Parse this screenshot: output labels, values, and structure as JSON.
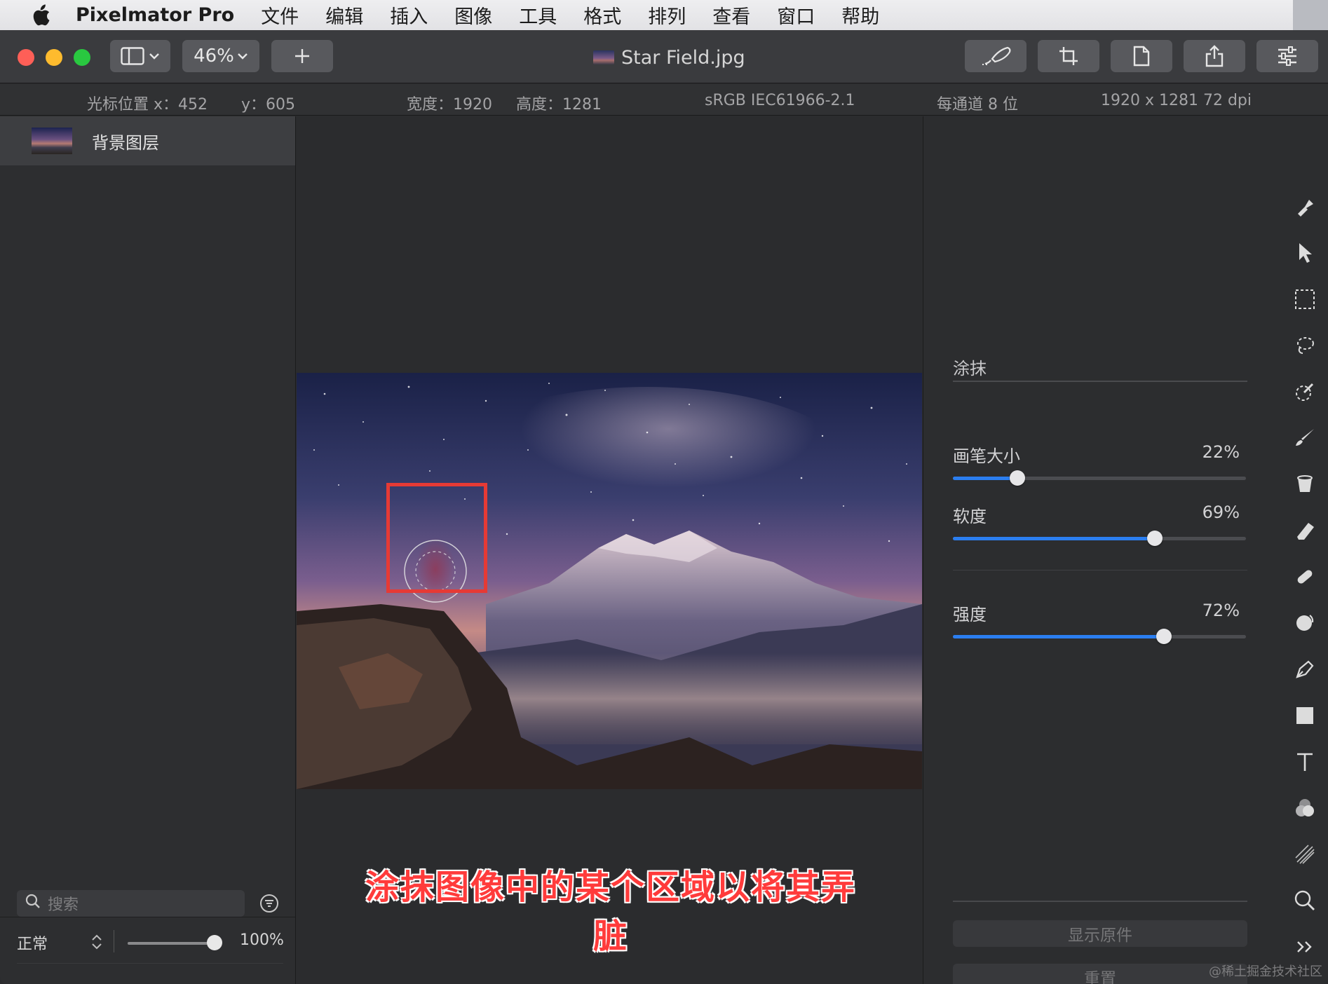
{
  "menubar": {
    "app_name": "Pixelmator Pro",
    "items": [
      "文件",
      "编辑",
      "插入",
      "图像",
      "工具",
      "格式",
      "排列",
      "查看",
      "窗口",
      "帮助"
    ]
  },
  "toolbar": {
    "zoom": "46%",
    "document_title": "Star Field.jpg"
  },
  "infobar": {
    "cursor_x": "光标位置 x：452",
    "cursor_y": "y：605",
    "width": "宽度：1920",
    "height": "高度：1281",
    "color_profile": "sRGB IEC61966-2.1",
    "bit_depth": "每通道 8 位",
    "resolution": "1920 x 1281 72 dpi"
  },
  "layers": {
    "items": [
      {
        "name": "背景图层"
      }
    ],
    "blend_mode": "正常",
    "opacity": "100%",
    "opacity_fraction": 1.0,
    "search_placeholder": "搜索"
  },
  "canvas": {
    "caption": "涂抹图像中的某个区域以将其弄脏"
  },
  "inspector": {
    "tool_name": "涂抹",
    "params": [
      {
        "label": "画笔大小",
        "value": "22%",
        "fraction": 0.22
      },
      {
        "label": "软度",
        "value": "69%",
        "fraction": 0.69
      },
      {
        "label": "强度",
        "value": "72%",
        "fraction": 0.72
      }
    ],
    "show_original": "显示原件",
    "reset": "重置"
  },
  "tools": [
    "style-tool-icon",
    "arrange-tool-icon",
    "rect-select-icon",
    "lasso-select-icon",
    "magic-select-icon",
    "paint-brush-icon",
    "fill-bucket-icon",
    "eraser-icon",
    "repair-icon",
    "retouch-icon",
    "pen-icon",
    "shape-icon",
    "type-icon",
    "color-adjust-icon",
    "effects-icon",
    "zoom-icon",
    "more-tools-icon"
  ],
  "colors": {
    "accent": "#2b7ef0",
    "highlight_frame": "#e63a35",
    "caption": "#ff3b3b"
  },
  "watermark": "@稀土掘金技术社区"
}
